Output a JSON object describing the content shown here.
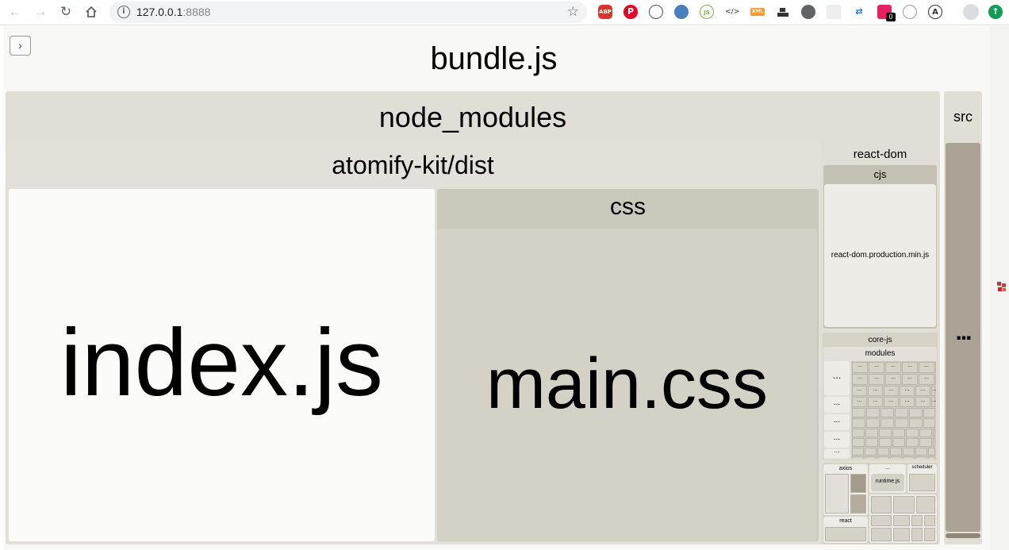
{
  "browser": {
    "url_host": "127.0.0.1",
    "url_port": ":8888",
    "ext_adblock": "ABP",
    "ext_pinterest": "P",
    "ext_json": "JS",
    "ext_devtools": "</>",
    "ext_xml": "XML",
    "ext_badge": "0",
    "ext_letter": "A"
  },
  "treemap": {
    "root": "bundle.js",
    "node_modules": "node_modules",
    "atomify": "atomify-kit/dist",
    "index_js": "index.js",
    "css": "css",
    "main_css": "main.css",
    "react_dom": "react-dom",
    "cjs": "cjs",
    "react_dom_prod": "react-dom.production.min.js",
    "core_js": "core-js",
    "modules": "modules",
    "ellipsis": "...",
    "axios": "axios",
    "runtime": "runtime.js",
    "scheduler": "scheduler",
    "react": "react",
    "src": "src",
    "src_more": "..."
  },
  "colors": {
    "index_js_fill": "#fbfbf9",
    "css_group": "#cbc8bc",
    "main_css_fill": "#d4d1c7",
    "src_group": "#aba496",
    "accent_green": "#0f9d58"
  }
}
